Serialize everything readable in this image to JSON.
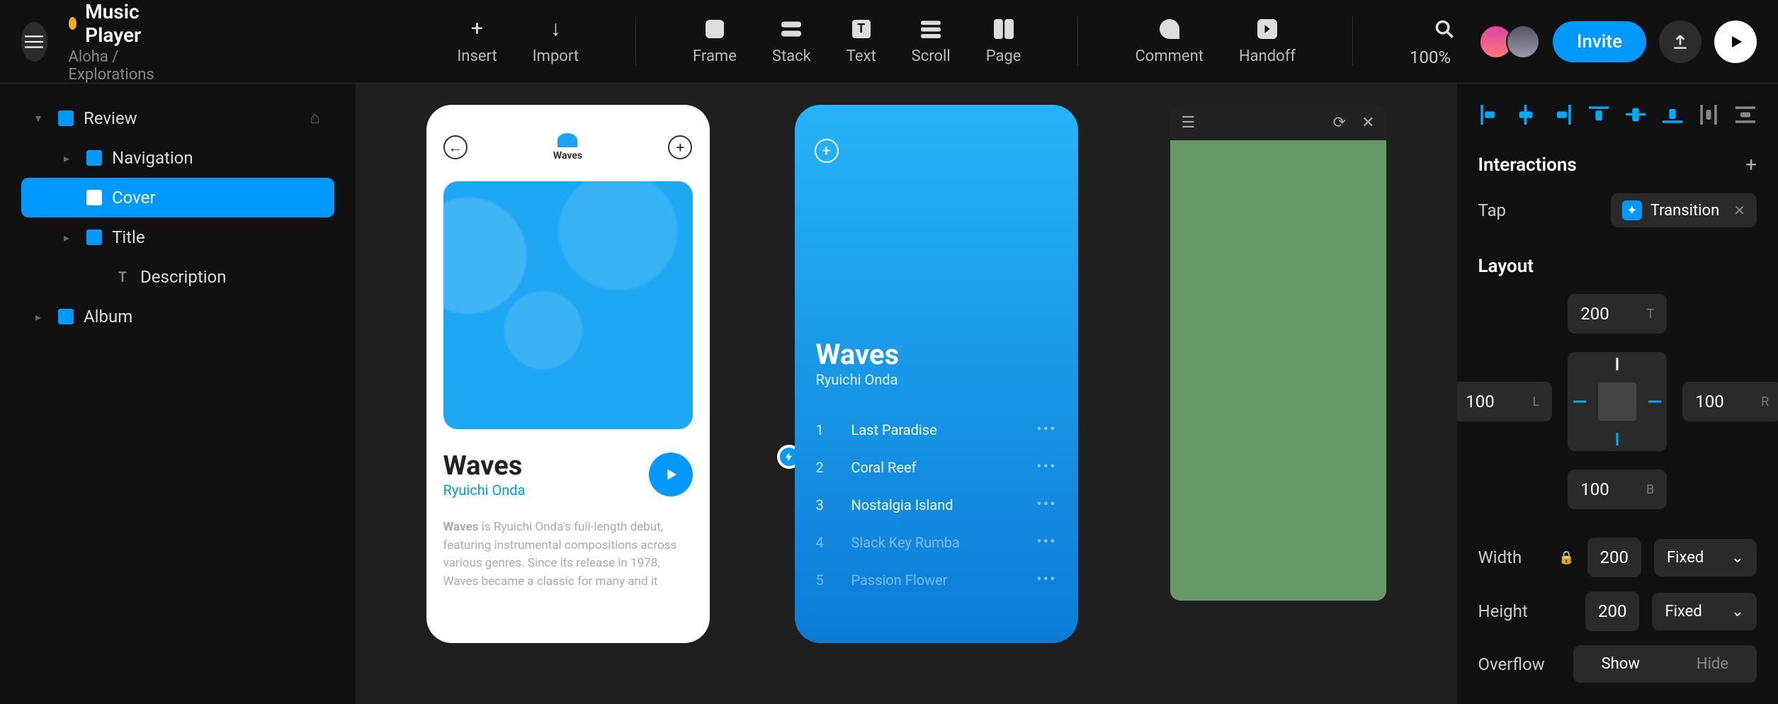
{
  "header": {
    "title": "Music Player",
    "subtitle": "Aloha / Explorations",
    "invite_label": "Invite",
    "zoom": "100%"
  },
  "toolbar": {
    "insert": "Insert",
    "import": "Import",
    "frame": "Frame",
    "stack": "Stack",
    "text": "Text",
    "scroll": "Scroll",
    "page": "Page",
    "comment": "Comment",
    "handoff": "Handoff"
  },
  "tree": {
    "review": "Review",
    "navigation": "Navigation",
    "cover": "Cover",
    "title": "Title",
    "description": "Description",
    "album": "Album"
  },
  "canvas": {
    "screen1": {
      "logo_text": "Waves",
      "album_title": "Waves",
      "album_artist": "Ryuichi Onda",
      "desc_bold": "Waves",
      "desc_rest": " is Ryuichi Onda's full-length debut, featuring instrumental compositions across various genres. Since its release in 1978, Waves became a classic for many and it"
    },
    "screen2": {
      "title": "Waves",
      "artist": "Ryuichi Onda",
      "tracks": [
        {
          "n": "1",
          "name": "Last Paradise"
        },
        {
          "n": "2",
          "name": "Coral Reef"
        },
        {
          "n": "3",
          "name": "Nostalgia Island"
        },
        {
          "n": "4",
          "name": "Slack Key Rumba"
        },
        {
          "n": "5",
          "name": "Passion Flower"
        }
      ]
    }
  },
  "panel": {
    "interactions_title": "Interactions",
    "tap_label": "Tap",
    "transition_label": "Transition",
    "layout_title": "Layout",
    "top": "200",
    "top_lbl": "T",
    "left": "100",
    "left_lbl": "L",
    "right": "100",
    "right_lbl": "R",
    "bottom": "100",
    "bottom_lbl": "B",
    "width_label": "Width",
    "width_val": "200",
    "width_mode": "Fixed",
    "height_label": "Height",
    "height_val": "200",
    "height_mode": "Fixed",
    "overflow_label": "Overflow",
    "overflow_show": "Show",
    "overflow_hide": "Hide"
  }
}
